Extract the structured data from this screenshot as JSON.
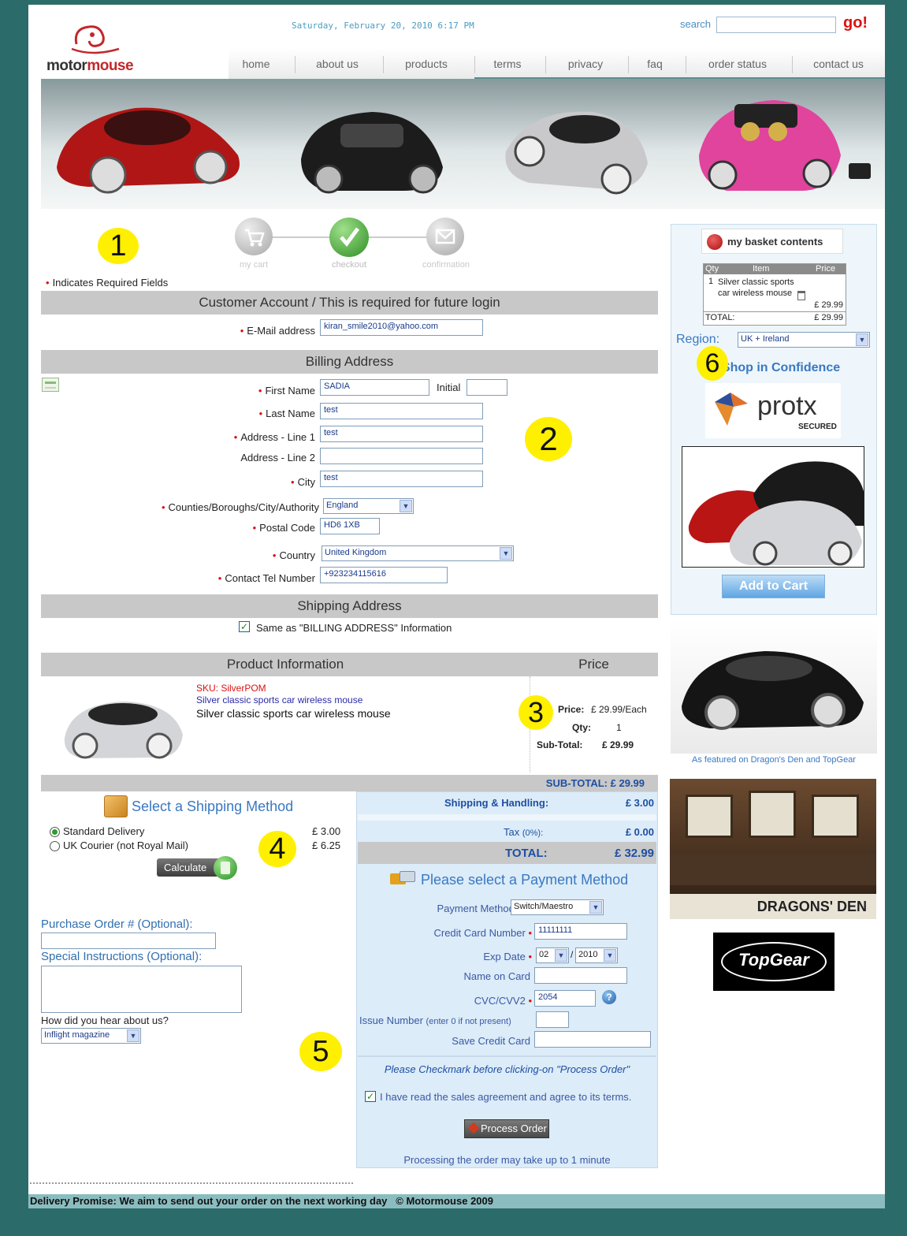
{
  "header": {
    "brand_a": "motor",
    "brand_b": "mouse",
    "datetime": "Saturday, February 20, 2010 6:17 PM",
    "search_label": "search",
    "search_value": "",
    "go_label": "go!"
  },
  "nav": [
    "home",
    "about us",
    "products",
    "terms",
    "privacy",
    "faq",
    "order status",
    "contact us"
  ],
  "steps": {
    "s1": "my cart",
    "s2": "checkout",
    "s3": "confirmation"
  },
  "badges": {
    "b1": "1",
    "b2": "2",
    "b3": "3",
    "b4": "4",
    "b5": "5",
    "b6": "6"
  },
  "required_note": "Indicates Required Fields",
  "customer": {
    "title": "Customer Account / This is required for future login",
    "email_label": "E-Mail address",
    "email_value": "kiran_smile2010@yahoo.com"
  },
  "billing": {
    "title": "Billing Address",
    "first_name_label": "First Name",
    "first_name": "SADIA",
    "initial_label": "Initial",
    "initial": "",
    "last_name_label": "Last Name",
    "last_name": "test",
    "addr1_label": "Address - Line 1",
    "addr1": "test",
    "addr2_label": "Address - Line 2",
    "addr2": "",
    "city_label": "City",
    "city": "test",
    "county_label": "Counties/Boroughs/City/Authority",
    "county": "England",
    "postal_label": "Postal Code",
    "postal": "HD6 1XB",
    "country_label": "Country",
    "country": "United Kingdom",
    "tel_label": "Contact Tel Number",
    "tel": "+923234115616"
  },
  "shipping_addr": {
    "title": "Shipping Address",
    "same_label": "Same as \"BILLING ADDRESS\" Information"
  },
  "product": {
    "header_left": "Product Information",
    "header_right": "Price",
    "sku": "SKU: SilverPOM",
    "link": "Silver classic sports car wireless mouse",
    "name": "Silver classic sports car wireless mouse",
    "price_label": "Price:",
    "price": "£ 29.99/Each",
    "qty_label": "Qty:",
    "qty": "1",
    "subtotal_label": "Sub-Total:",
    "subtotal": "£ 29.99"
  },
  "totals": {
    "subtotal": "SUB-TOTAL: £ 29.99",
    "sh_label": "Shipping & Handling:",
    "sh_value": "£ 3.00",
    "tax_label": "Tax",
    "tax_pct": "(0%):",
    "tax_value": "£ 0.00",
    "total_label": "TOTAL:",
    "total_value": "£ 32.99"
  },
  "shipping_method": {
    "title": "Select a Shipping Method",
    "opt1": "Standard Delivery",
    "opt1_price": "£ 3.00",
    "opt2": "UK Courier (not Royal Mail)",
    "opt2_price": "£ 6.25",
    "calculate": "Calculate"
  },
  "extras": {
    "po_label": "Purchase Order # (Optional):",
    "po_value": "",
    "instructions_label": "Special Instructions (Optional):",
    "instructions_value": "",
    "hear_label": "How did you hear about us?",
    "hear_value": "Inflight magazine"
  },
  "payment": {
    "title": "Please select a Payment Method",
    "method_label": "Payment Method",
    "method": "Switch/Maestro",
    "cc_label": "Credit Card Number",
    "cc": "11111111",
    "exp_label": "Exp Date",
    "exp_month": "02",
    "exp_year": "2010",
    "name_label": "Name on Card",
    "name": "",
    "cvc_label": "CVC/CVV2",
    "cvc": "2054",
    "issue_label": "Issue Number",
    "issue_hint": "(enter 0 if not present)",
    "issue": "",
    "save_label": "Save Credit Card",
    "save": "",
    "notice": "Please Checkmark before clicking-on \"Process Order\"",
    "agree": "I have read the sales agreement and agree to its terms.",
    "process": "Process Order",
    "processing_note": "Processing the order may take up to 1 minute"
  },
  "sidebar": {
    "basket_title": "my basket contents",
    "col_qty": "Qty",
    "col_item": "Item",
    "col_price": "Price",
    "row_qty": "1",
    "row_item": "Silver classic sports car wireless mouse",
    "row_price": "£ 29.99",
    "total_label": "TOTAL:",
    "total_value": "£ 29.99",
    "region_label": "Region:",
    "region": "UK + Ireland",
    "shop_confidence": "Shop in Confidence",
    "protx": "protx",
    "protx_secured": "SECURED",
    "add_to_cart": "Add to Cart",
    "featured": "As featured on Dragon's Den and TopGear",
    "dragons": "DRAGONS' DEN",
    "topgear": "TopGear"
  },
  "footer": {
    "promise": "Delivery Promise: We aim to send out your order on the next working day",
    "copyright": "© Motormouse 2009"
  },
  "colors": {
    "teal": "#2b6c6a",
    "accent_red": "#d11111",
    "link_blue": "#3a58a6",
    "panel_blue": "#dcecf8"
  }
}
